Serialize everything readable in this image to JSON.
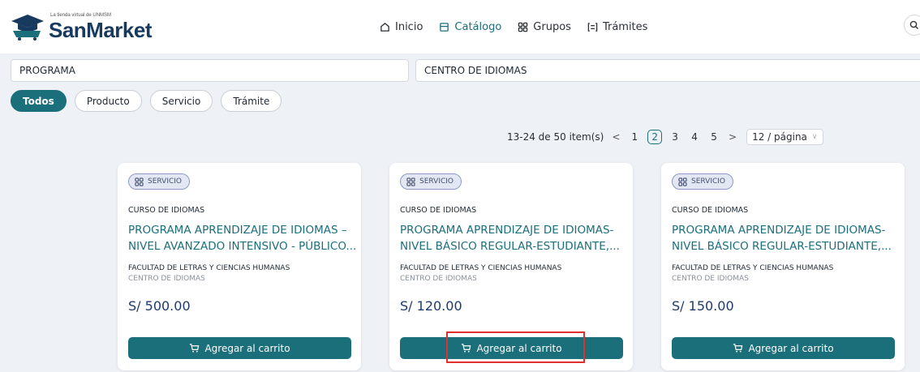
{
  "logo": {
    "tagline": "La tienda virtual de UNMSM",
    "name": "SanMarket"
  },
  "nav": [
    {
      "label": "Inicio",
      "icon": "home-icon",
      "active": false
    },
    {
      "label": "Catálogo",
      "icon": "catalog-icon",
      "active": true
    },
    {
      "label": "Grupos",
      "icon": "grid-icon",
      "active": false
    },
    {
      "label": "Trámites",
      "icon": "list-icon",
      "active": false
    }
  ],
  "filters": {
    "program": "PROGRAMA",
    "center": "CENTRO DE IDIOMAS"
  },
  "types": [
    "Todos",
    "Producto",
    "Servicio",
    "Trámite"
  ],
  "active_type": "Todos",
  "pagination": {
    "summary": "13-24 de 50 item(s)",
    "pages": [
      "1",
      "2",
      "3",
      "4",
      "5"
    ],
    "current": "2",
    "page_size": "12 / página"
  },
  "cards": [
    {
      "badge": "SERVICIO",
      "category": "CURSO DE IDIOMAS",
      "title_line1": "PROGRAMA APRENDIZAJE DE IDIOMAS –",
      "title_line2": "NIVEL AVANZADO INTENSIVO - PÚBLICO...",
      "faculty": "FACULTAD DE LETRAS Y CIENCIAS HUMANAS",
      "center": "CENTRO DE IDIOMAS",
      "price": "S/ 500.00",
      "button": "Agregar al carrito"
    },
    {
      "badge": "SERVICIO",
      "category": "CURSO DE IDIOMAS",
      "title_line1": "PROGRAMA APRENDIZAJE DE IDIOMAS-",
      "title_line2": "NIVEL BÁSICO REGULAR-ESTUDIANTE,...",
      "faculty": "FACULTAD DE LETRAS Y CIENCIAS HUMANAS",
      "center": "CENTRO DE IDIOMAS",
      "price": "S/ 120.00",
      "button": "Agregar al carrito"
    },
    {
      "badge": "SERVICIO",
      "category": "CURSO DE IDIOMAS",
      "title_line1": "PROGRAMA APRENDIZAJE DE IDIOMAS-",
      "title_line2": "NIVEL BÁSICO REGULAR-ESTUDIANTE,...",
      "faculty": "FACULTAD DE LETRAS Y CIENCIAS HUMANAS",
      "center": "CENTRO DE IDIOMAS",
      "price": "S/ 150.00",
      "button": "Agregar al carrito"
    }
  ],
  "colors": {
    "primary": "#1b6f7b",
    "brand": "#173a5e",
    "highlight": "#e0302e"
  }
}
